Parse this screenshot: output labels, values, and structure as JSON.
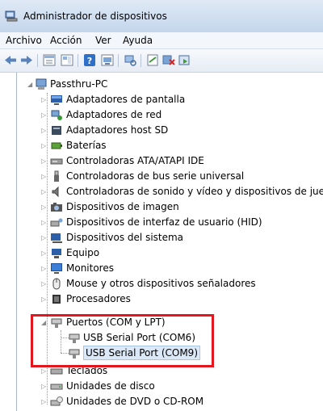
{
  "window": {
    "title": "Administrador de dispositivos"
  },
  "menu": [
    "Archivo",
    "Acción",
    "Ver",
    "Ayuda"
  ],
  "toolbar_icons": [
    "back-icon",
    "forward-icon",
    "properties-icon",
    "view-icon",
    "help-icon",
    "update-driver-icon",
    "scan-hardware-icon",
    "disable-icon",
    "uninstall-icon",
    "enable-icon"
  ],
  "tree": {
    "root": "Passthru-PC",
    "categories": [
      "Adaptadores de pantalla",
      "Adaptadores de red",
      "Adaptadores host SD",
      "Baterías",
      "Controladoras ATA/ATAPI IDE",
      "Controladoras de bus serie universal",
      "Controladoras de sonido y vídeo y dispositivos de juego",
      "Dispositivos de imagen",
      "Dispositivos de interfaz de usuario (HID)",
      "Dispositivos del sistema",
      "Equipo",
      "Monitores",
      "Mouse y otros dispositivos señaladores",
      "Procesadores",
      "Puertos (COM y LPT)",
      "Teclados",
      "Unidades de disco",
      "Unidades de DVD o CD-ROM"
    ],
    "ports_children": [
      "USB Serial Port (COM6)",
      "USB Serial Port (COM9)"
    ],
    "selected": "USB Serial Port (COM9)"
  },
  "colors": {
    "highlight_box": "#e3161d",
    "selection": "#dbe8f8"
  }
}
